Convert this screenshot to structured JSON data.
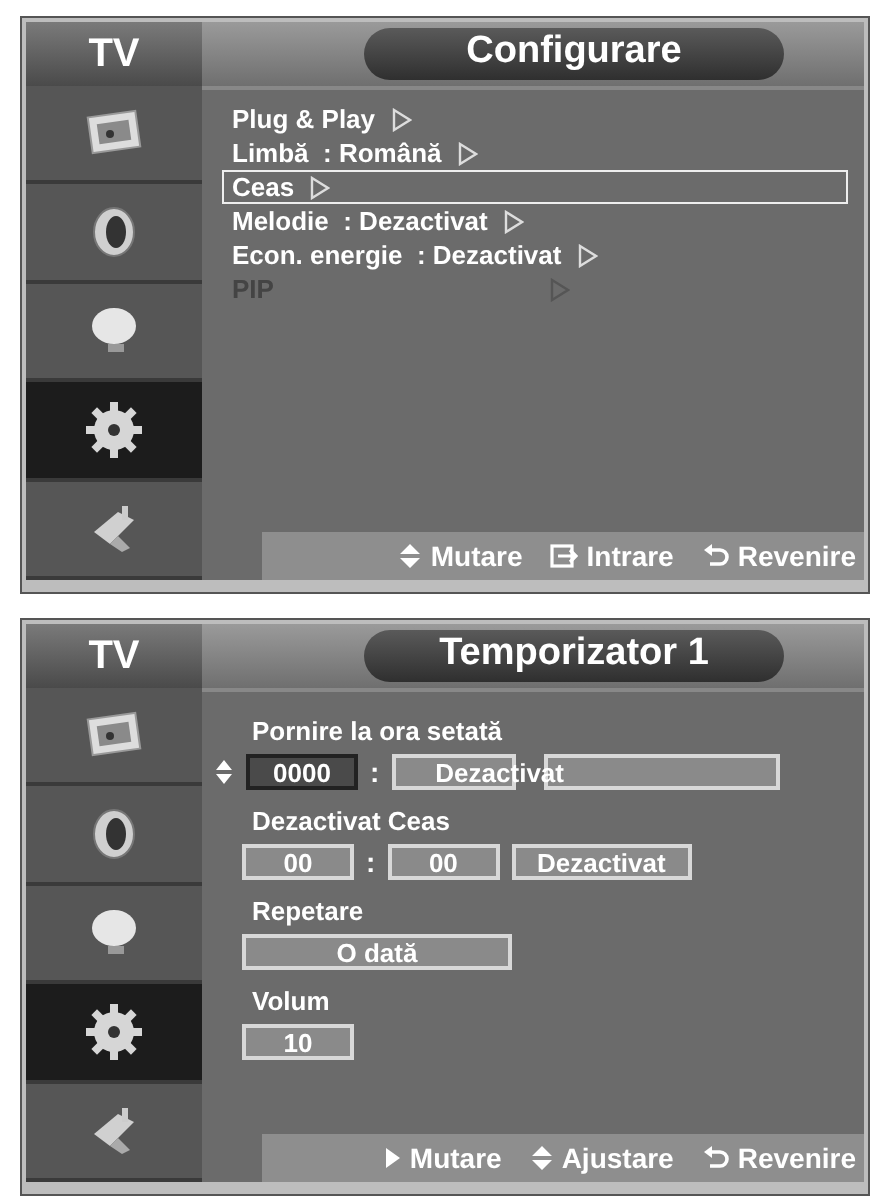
{
  "screens": [
    {
      "brand": "TV",
      "title": "Configurare",
      "sidebar": [
        {
          "kind": "picture",
          "selected": false
        },
        {
          "kind": "sound",
          "selected": false
        },
        {
          "kind": "channel",
          "selected": false
        },
        {
          "kind": "setup",
          "selected": true
        },
        {
          "kind": "input",
          "selected": false
        }
      ],
      "menu": [
        {
          "label": "Plug & Play",
          "selected": false,
          "disabled": false
        },
        {
          "label": "Limbă",
          "value": ": Română",
          "selected": false,
          "disabled": false
        },
        {
          "label": "Ceas",
          "selected": true,
          "disabled": false
        },
        {
          "label": "Melodie",
          "value": ": Dezactivat",
          "selected": false,
          "disabled": false
        },
        {
          "label": "Econ. energie",
          "value": ": Dezactivat",
          "selected": false,
          "disabled": false
        },
        {
          "label": "PIP",
          "selected": false,
          "disabled": true
        }
      ],
      "footer": [
        {
          "kind": "updown",
          "text": "Mutare"
        },
        {
          "kind": "enter",
          "text": "Intrare"
        },
        {
          "kind": "return",
          "text": "Revenire"
        }
      ]
    },
    {
      "brand": "TV",
      "title": "Temporizator 1",
      "sidebar": [
        {
          "kind": "picture",
          "selected": false
        },
        {
          "kind": "sound",
          "selected": false
        },
        {
          "kind": "channel",
          "selected": false
        },
        {
          "kind": "setup",
          "selected": true
        },
        {
          "kind": "input",
          "selected": false
        }
      ],
      "sections": [
        {
          "label": "Pornire la ora setată",
          "fields": [
            {
              "kind": "spin"
            },
            {
              "kind": "short",
              "value": "0000",
              "focused": true
            },
            {
              "kind": "colon",
              "value": ":"
            },
            {
              "kind": "split",
              "value": "Dezactivat"
            }
          ]
        },
        {
          "label": "Dezactivat Ceas",
          "fields": [
            {
              "kind": "short",
              "value": "00",
              "focused": false
            },
            {
              "kind": "colon",
              "value": ":"
            },
            {
              "kind": "short",
              "value": "00",
              "focused": false
            },
            {
              "kind": "long",
              "value": "Dezactivat",
              "focused": false
            }
          ]
        },
        {
          "label": "Repetare",
          "fields": [
            {
              "kind": "wide",
              "value": "O dată",
              "focused": false
            }
          ]
        },
        {
          "label": "Volum",
          "fields": [
            {
              "kind": "short",
              "value": "10",
              "focused": false
            }
          ]
        }
      ],
      "footer": [
        {
          "kind": "right",
          "text": "Mutare"
        },
        {
          "kind": "updown",
          "text": "Ajustare"
        },
        {
          "kind": "return",
          "text": "Revenire"
        }
      ]
    }
  ]
}
